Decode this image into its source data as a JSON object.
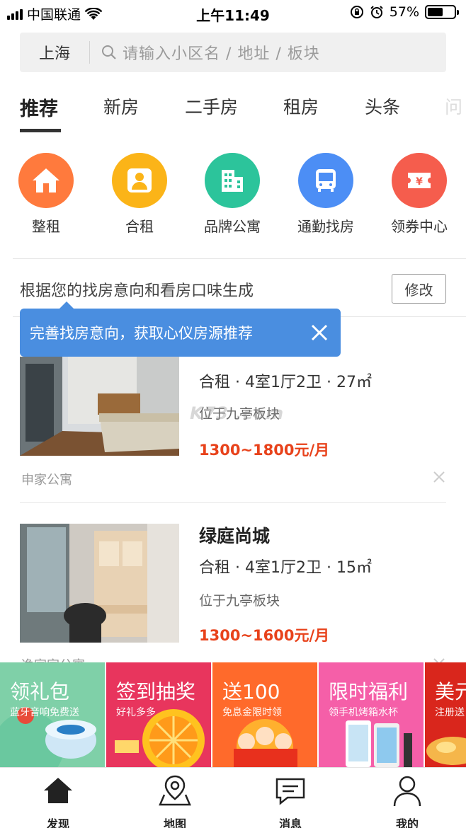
{
  "status_bar": {
    "carrier": "中国联通",
    "time": "上午11:49",
    "battery": "57%",
    "battery_level": 0.57
  },
  "search": {
    "city": "上海",
    "placeholder": "请输入小区名 / 地址 / 板块"
  },
  "tabs": [
    {
      "label": "推荐",
      "active": true
    },
    {
      "label": "新房"
    },
    {
      "label": "二手房"
    },
    {
      "label": "租房"
    },
    {
      "label": "头条"
    },
    {
      "label": "问"
    }
  ],
  "categories": [
    {
      "label": "整租",
      "icon": "house-icon",
      "color": "#ff7a3d"
    },
    {
      "label": "合租",
      "icon": "person-house-icon",
      "color": "#fbb418"
    },
    {
      "label": "品牌公寓",
      "icon": "building-icon",
      "color": "#2cc49b"
    },
    {
      "label": "通勤找房",
      "icon": "bus-icon",
      "color": "#4c8ef5"
    },
    {
      "label": "领券中心",
      "icon": "coupon-icon",
      "color": "#f55d4d"
    }
  ],
  "recommend": {
    "text": "根据您的找房意向和看房口味生成",
    "modify_label": "修改",
    "tooltip": "完善找房意向，获取心仪房源推荐"
  },
  "listings": [
    {
      "title": "",
      "spec": "合租 · 4室1厅2卫 · 27㎡",
      "location": "位于九亭板块",
      "price": "1300~1800元/月",
      "source": "申家公寓"
    },
    {
      "title": "绿庭尚城",
      "spec": "合租 · 4室1厅2卫 · 15㎡",
      "location": "位于九亭板块",
      "price": "1300~1600元/月",
      "source": "逸家家公寓"
    }
  ],
  "watermark": "K73 .com",
  "promos": [
    {
      "title": "领礼包",
      "subtitle": "蓝牙音响免费送",
      "color": "#7fd0a8"
    },
    {
      "title": "签到抽奖",
      "subtitle": "好礼多多",
      "color": "#e8355d"
    },
    {
      "title": "送100",
      "subtitle": "免息金限时领",
      "color": "#ff6a2b"
    },
    {
      "title": "限时福利",
      "subtitle": "领手机烤箱水杯",
      "color": "#f55fa8"
    },
    {
      "title": "美元",
      "subtitle": "注册送",
      "color": "#d9261c"
    }
  ],
  "nav": [
    {
      "label": "发现",
      "icon": "home-icon"
    },
    {
      "label": "地图",
      "icon": "map-icon"
    },
    {
      "label": "消息",
      "icon": "message-icon"
    },
    {
      "label": "我的",
      "icon": "profile-icon"
    }
  ]
}
